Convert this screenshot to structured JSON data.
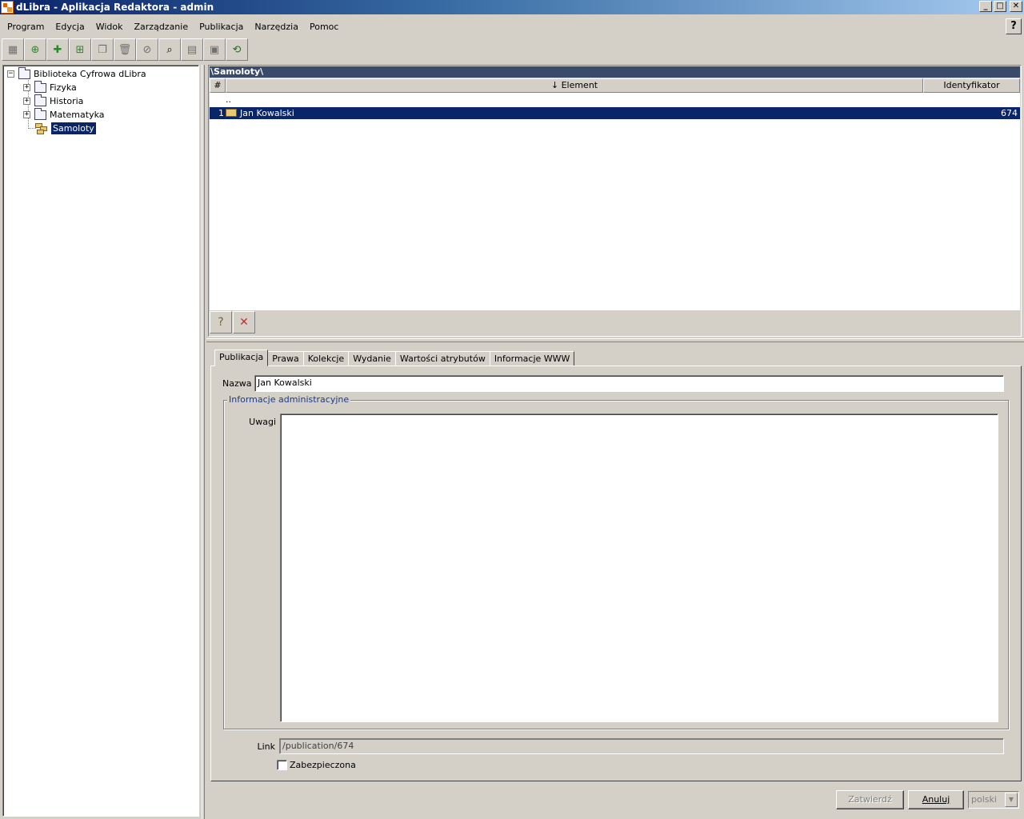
{
  "window": {
    "title": "dLibra - Aplikacja Redaktora - admin",
    "btn_minimize": "_",
    "btn_maximize": "□",
    "btn_close": "✕"
  },
  "menu": [
    "Program",
    "Edycja",
    "Widok",
    "Zarządzanie",
    "Publikacja",
    "Narzędzia",
    "Pomoc"
  ],
  "help_pointer": "?",
  "toolbar_icons": [
    "document-icon",
    "add-directory-icon",
    "add-publication-icon",
    "add-edition-icon",
    "copy-icon",
    "delete-icon",
    "remove-icon",
    "search-icon",
    "properties-icon",
    "publish-icon",
    "refresh-icon"
  ],
  "tree": {
    "root": "Biblioteka Cyfrowa dLibra",
    "items": [
      {
        "label": "Fizyka",
        "expander": "+"
      },
      {
        "label": "Historia",
        "expander": "+"
      },
      {
        "label": "Matematyka",
        "expander": "+"
      },
      {
        "label": "Samoloty",
        "selected": true
      }
    ],
    "root_expander": "−"
  },
  "list": {
    "path": "\\Samoloty\\",
    "columns": {
      "num": "#",
      "element": "↓ Element",
      "identifier": "Identyfikator"
    },
    "parent_row": "..",
    "rows": [
      {
        "num": "1",
        "name": "Jan Kowalski",
        "id": "674",
        "selected": true
      }
    ]
  },
  "tabs": [
    "Publikacja",
    "Prawa",
    "Kolekcje",
    "Wydanie",
    "Wartości atrybutów",
    "Informacje WWW"
  ],
  "form": {
    "name_label": "Nazwa",
    "name_value": "Jan Kowalski",
    "group_title": "Informacje administracyjne",
    "notes_label": "Uwagi",
    "notes_value": "",
    "link_label": "Link",
    "link_value": "/publication/674",
    "secured_label": "Zabezpieczona"
  },
  "buttons": {
    "confirm": "Zatwierdź",
    "cancel": "Anuluj",
    "language": "polski"
  }
}
